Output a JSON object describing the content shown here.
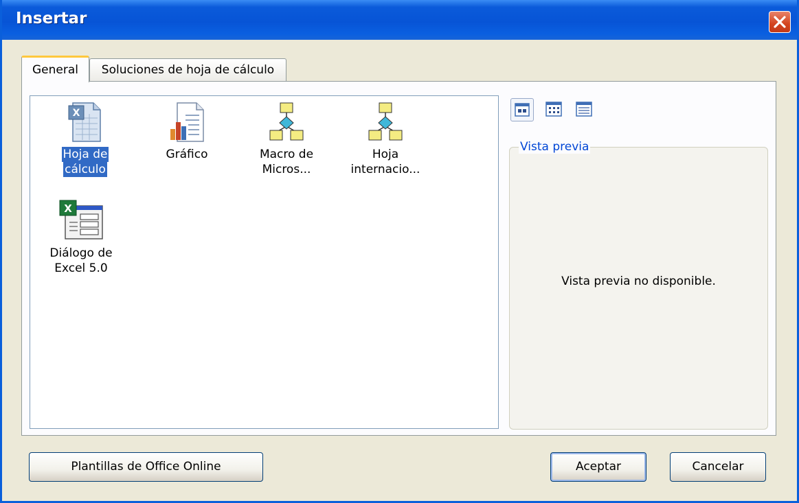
{
  "window": {
    "title": "Insertar"
  },
  "tabs": [
    {
      "label": "General",
      "active": true
    },
    {
      "label": "Soluciones de hoja de cálculo",
      "active": false
    }
  ],
  "items": [
    {
      "line1": "Hoja de",
      "line2": "cálculo",
      "icon": "spreadsheet-icon",
      "selected": true
    },
    {
      "line1": "Gráfico",
      "line2": "",
      "icon": "chart-document-icon",
      "selected": false
    },
    {
      "line1": "Macro de",
      "line2": "Micros...",
      "icon": "macro-flowchart-icon",
      "selected": false
    },
    {
      "line1": "Hoja",
      "line2": "internacio...",
      "icon": "macro-flowchart-icon",
      "selected": false
    },
    {
      "line1": "Diálogo de",
      "line2": "Excel 5.0",
      "icon": "excel-dialog-icon",
      "selected": false
    }
  ],
  "view_buttons": [
    "large-icons-view-icon",
    "list-view-icon",
    "details-view-icon"
  ],
  "preview": {
    "legend": "Vista previa",
    "message": "Vista previa no disponible."
  },
  "buttons": {
    "office_online": "Plantillas de Office Online",
    "ok": "Aceptar",
    "cancel": "Cancelar"
  },
  "colors": {
    "titlebar": "#0754D6",
    "selection": "#316AC5",
    "legend": "#0046D5",
    "close": "#D3431E"
  }
}
